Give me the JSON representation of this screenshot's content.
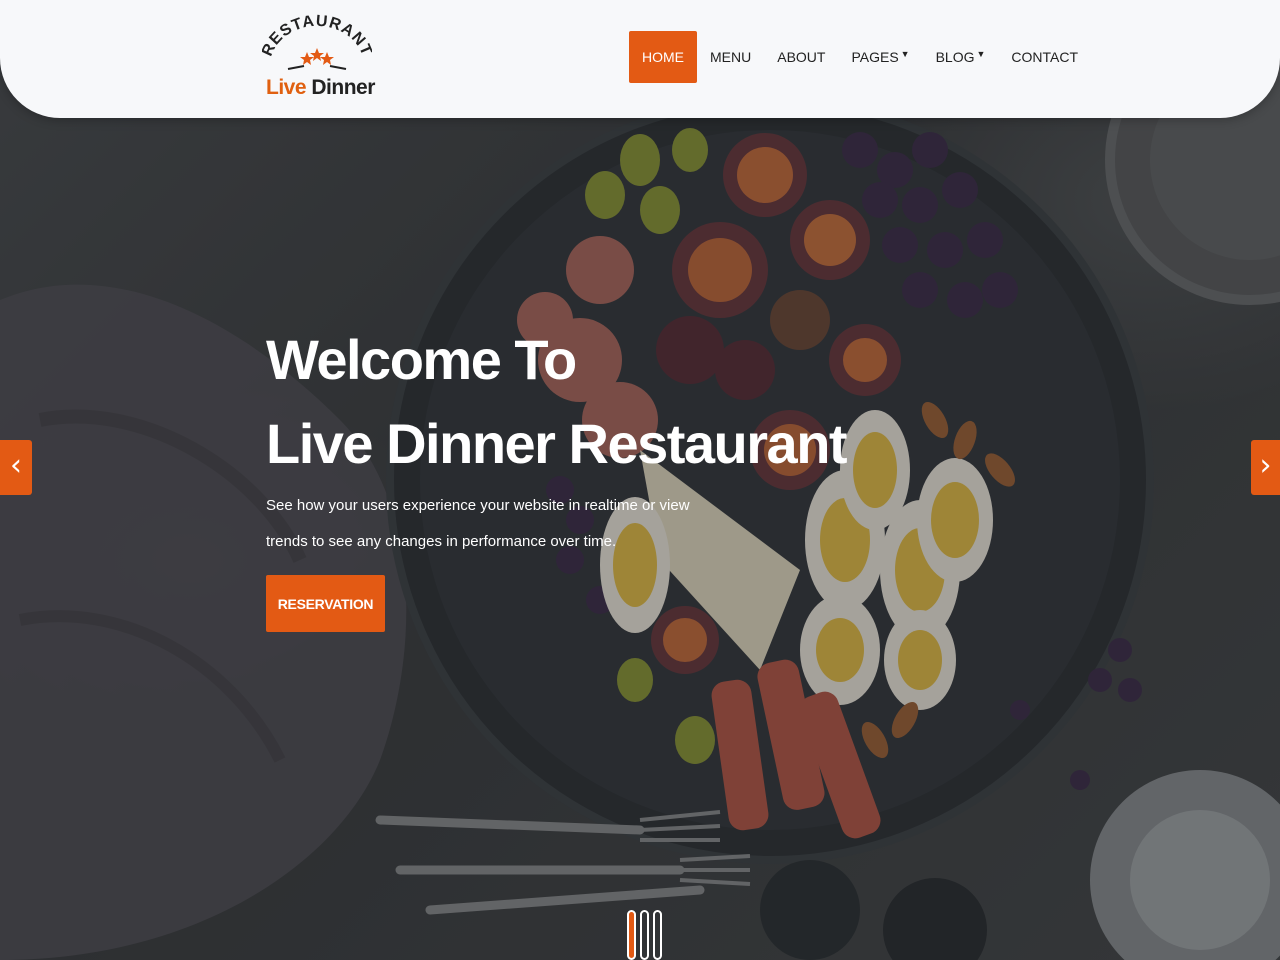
{
  "brand": {
    "arc_text": "RESTAURANT",
    "name_part1": "Live",
    "name_part2": "Dinner",
    "accent_color": "#e35a14"
  },
  "nav": {
    "items": [
      {
        "label": "HOME",
        "active": true
      },
      {
        "label": "MENU",
        "active": false
      },
      {
        "label": "ABOUT",
        "active": false
      },
      {
        "label": "PAGES",
        "active": false,
        "dropdown": true
      },
      {
        "label": "BLOG",
        "active": false,
        "dropdown": true
      },
      {
        "label": "CONTACT",
        "active": false
      }
    ]
  },
  "hero": {
    "title_line1": "Welcome To",
    "title_line2": "Live Dinner Restaurant",
    "desc_line1": "See how your users experience your website in realtime or view",
    "desc_line2": "trends to see any changes in performance over time.",
    "button_label": "RESERVATION"
  },
  "slider": {
    "prev_icon": "chevron-left-icon",
    "next_icon": "chevron-right-icon",
    "prev_glyph": "‹",
    "next_glyph": "›",
    "slide_count": 3,
    "active_index": 0
  }
}
